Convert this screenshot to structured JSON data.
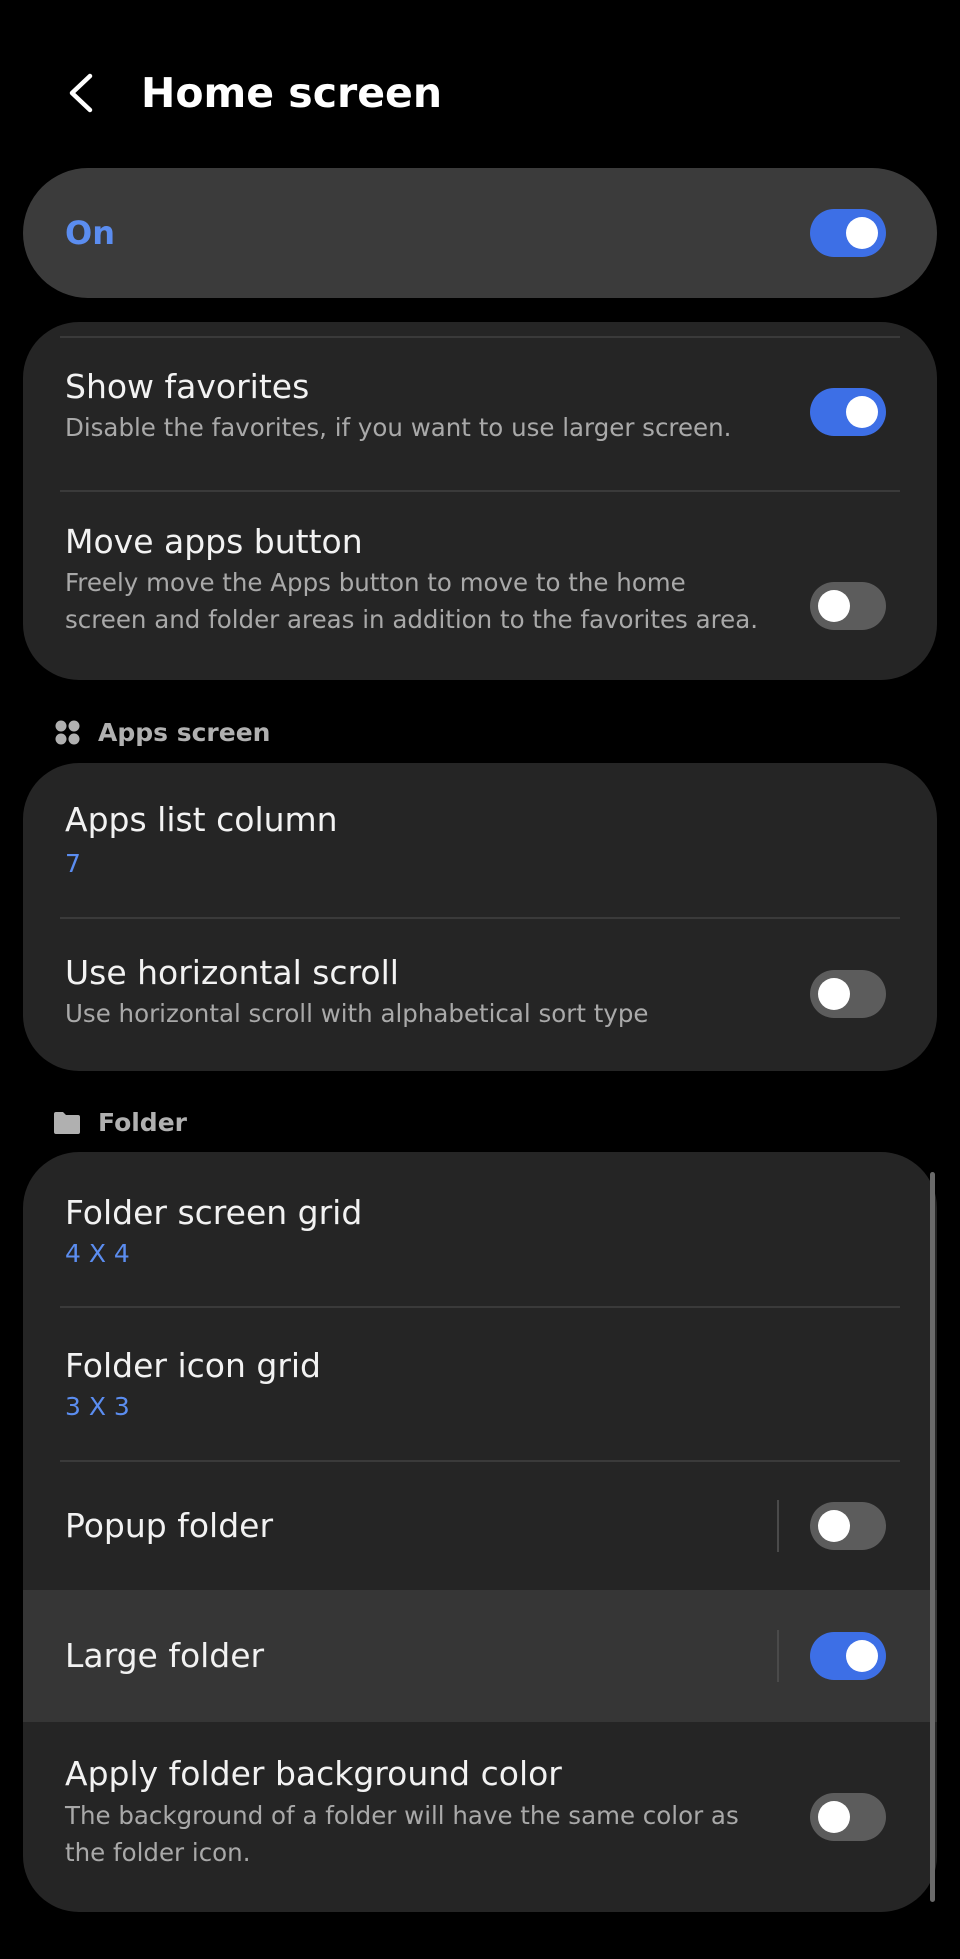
{
  "header": {
    "title": "Home screen",
    "back_icon": "chevron-left-icon"
  },
  "master": {
    "label": "On",
    "enabled": true
  },
  "home_group": {
    "items": [
      {
        "title": "Show favorites",
        "subtitle": "Disable the favorites, if you want to use larger screen.",
        "enabled": true
      },
      {
        "title": "Move apps button",
        "subtitle_line1": "Freely move the Apps button to move to the home",
        "subtitle_line2": "screen and folder areas in addition to the favorites area.",
        "enabled": false
      }
    ]
  },
  "apps_section": {
    "label": "Apps screen",
    "icon": "apps-grid-icon"
  },
  "apps_group": {
    "items": [
      {
        "title": "Apps list column",
        "value": "7"
      },
      {
        "title": "Use horizontal scroll",
        "subtitle": "Use horizontal scroll with alphabetical sort type",
        "enabled": false
      }
    ]
  },
  "folder_section": {
    "label": "Folder",
    "icon": "folder-icon"
  },
  "folder_group": {
    "items": [
      {
        "title": "Folder screen grid",
        "value": "4 X 4"
      },
      {
        "title": "Folder icon grid",
        "value": "3 X 3"
      },
      {
        "title": "Popup folder",
        "enabled": false
      },
      {
        "title": "Large folder",
        "enabled": true
      },
      {
        "title": "Apply folder background color",
        "subtitle_line1": "The background of a folder will have the same color as",
        "subtitle_line2": "the folder icon.",
        "enabled": false
      }
    ]
  },
  "colors": {
    "accent": "#3d6fe6",
    "accent_text": "#5b8df0",
    "card": "#252525",
    "background": "#000000"
  }
}
